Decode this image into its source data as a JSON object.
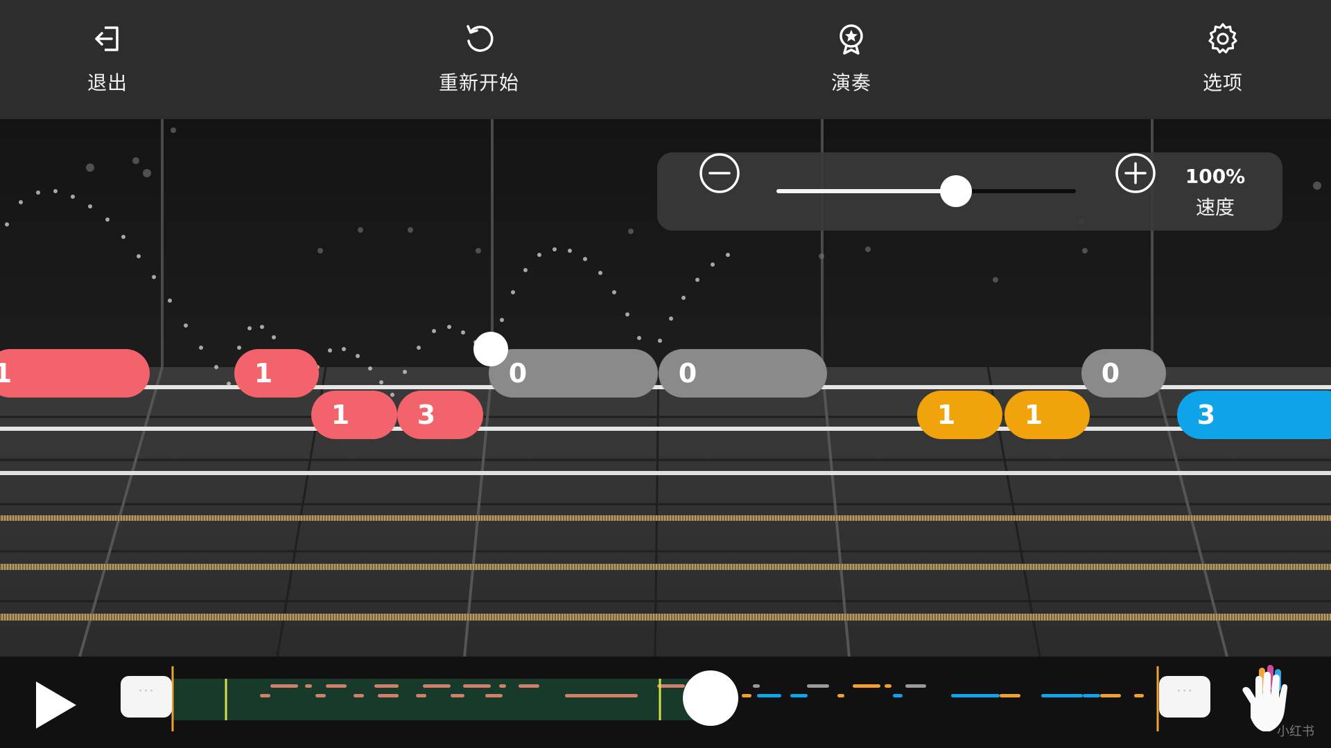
{
  "toolbar": {
    "exit_label": "退出",
    "restart_label": "重新开始",
    "play_mode_label": "演奏",
    "options_label": "选项"
  },
  "icons": {
    "exit": "exit-arrow-icon",
    "restart": "restart-icon",
    "play_mode": "award-star-icon",
    "options": "gear-icon",
    "minus": "minus-circle-icon",
    "plus": "plus-circle-icon",
    "play": "play-icon",
    "hand": "hand-icon"
  },
  "speed": {
    "value_label": "100%",
    "label": "速度",
    "slider_fraction": 0.6
  },
  "colors": {
    "red": "#f2636b",
    "gray": "#8a8a8a",
    "yellow": "#f0a30a",
    "blue": "#0fa4ea",
    "loop_marker": "#f0a030",
    "played_region": "#173a2a"
  },
  "notes": [
    {
      "fret": "1",
      "string": 1,
      "color": "red"
    },
    {
      "fret": "1",
      "string": 1,
      "color": "red"
    },
    {
      "fret": "1",
      "string": 2,
      "color": "red"
    },
    {
      "fret": "3",
      "string": 2,
      "color": "red"
    },
    {
      "fret": "0",
      "string": 1,
      "color": "gray"
    },
    {
      "fret": "0",
      "string": 1,
      "color": "gray"
    },
    {
      "fret": "0",
      "string": 1,
      "color": "gray"
    },
    {
      "fret": "1",
      "string": 2,
      "color": "yellow"
    },
    {
      "fret": "1",
      "string": 2,
      "color": "yellow"
    },
    {
      "fret": "3",
      "string": 2,
      "color": "blue"
    }
  ],
  "timeline": {
    "loop_start_label": "···",
    "loop_end_label": "···",
    "progress_fraction": 0.54
  },
  "watermark": "小红书"
}
